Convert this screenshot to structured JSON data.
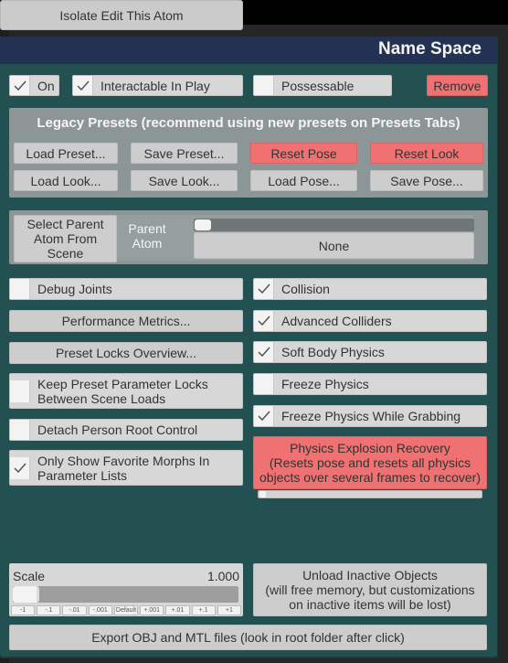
{
  "isolate_button": "Isolate Edit This Atom",
  "header": {
    "title": "Name Space"
  },
  "top_row": {
    "on": {
      "label": "On",
      "checked": true
    },
    "interactable": {
      "label": "Interactable In Play",
      "checked": true
    },
    "possessable": {
      "label": "Possessable",
      "checked": false
    },
    "remove": "Remove"
  },
  "legacy_presets": {
    "title": "Legacy Presets (recommend using new presets on Presets Tabs)",
    "buttons": [
      "Load Preset...",
      "Save Preset...",
      "Reset Pose",
      "Reset Look",
      "Load Look...",
      "Save Look...",
      "Load Pose...",
      "Save Pose..."
    ]
  },
  "parent": {
    "select_button": "Select Parent Atom From Scene",
    "label": "Parent Atom",
    "value": "None"
  },
  "left_column": {
    "debug_joints": {
      "label": "Debug Joints",
      "checked": false
    },
    "performance_metrics": "Performance Metrics...",
    "preset_locks_overview": "Preset Locks Overview...",
    "keep_locks": {
      "label": "Keep Preset Parameter Locks Between Scene Loads",
      "checked": false
    },
    "detach_root": {
      "label": "Detach Person Root Control",
      "checked": false
    },
    "favorite_morphs": {
      "label": "Only Show Favorite Morphs In Parameter Lists",
      "checked": true
    }
  },
  "right_column": {
    "collision": {
      "label": "Collision",
      "checked": true
    },
    "advanced_colliders": {
      "label": "Advanced Colliders",
      "checked": true
    },
    "soft_body": {
      "label": "Soft Body Physics",
      "checked": true
    },
    "freeze_physics": {
      "label": "Freeze Physics",
      "checked": false
    },
    "freeze_grabbing": {
      "label": "Freeze Physics While Grabbing",
      "checked": true
    },
    "explosion_recovery": {
      "line1": "Physics Explosion Recovery",
      "line2": "(Resets pose and resets all physics",
      "line3": "objects over several frames to recover)",
      "progress": 0
    }
  },
  "scale": {
    "label": "Scale",
    "value": "1.000",
    "steps": [
      "-1",
      "-.1",
      "-.01",
      "-.001",
      "Default",
      "+.001",
      "+.01",
      "+.1",
      "+1"
    ]
  },
  "unload": {
    "line1": "Unload Inactive Objects",
    "line2": "(will free memory, but customizations",
    "line3": "on inactive items will be lost)"
  },
  "export_button": "Export OBJ and MTL files (look in root folder after click)",
  "colors": {
    "header_bg": "#233152",
    "panel_bg": "#235151",
    "danger": "#f07171",
    "button": "#cdcdcd"
  }
}
